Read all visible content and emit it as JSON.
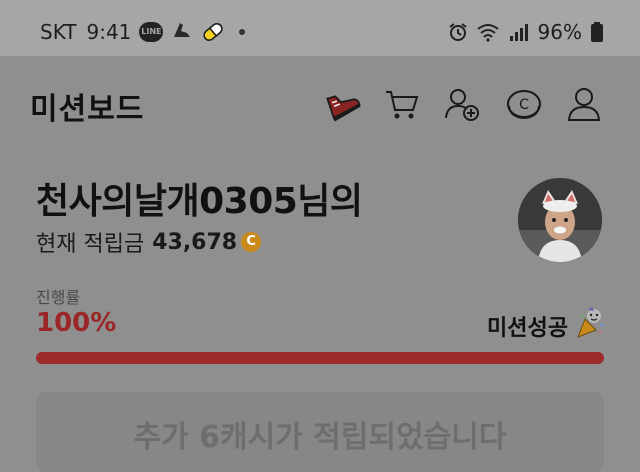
{
  "status_bar": {
    "carrier": "SKT",
    "time": "9:41",
    "line_icon_text": "LINE",
    "battery_percent": "96%"
  },
  "header": {
    "app_title": "미션보드",
    "icons": [
      "shoe-icon",
      "cart-icon",
      "add-friend-icon",
      "cash-coin-icon",
      "profile-icon"
    ]
  },
  "profile": {
    "username": "천사의날개0305님의",
    "points_label": "현재 적립금",
    "points_value": "43,678",
    "coin_symbol": "C"
  },
  "progress": {
    "label": "진행률",
    "percent_text": "100%",
    "fraction": 1.0,
    "status_text": "미션성공"
  },
  "reward": {
    "message": "추가 6캐시가 적립되었습니다"
  },
  "colors": {
    "accent_red": "#9f2a2a",
    "coin": "#c98a1a",
    "overlay": "#8f8f8f"
  }
}
